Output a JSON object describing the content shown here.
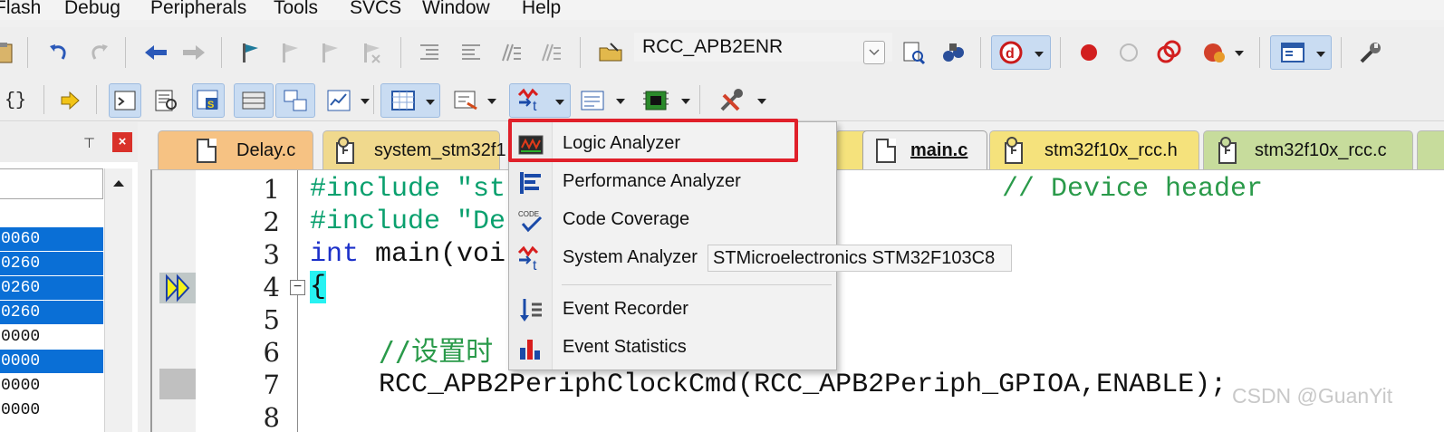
{
  "menubar": {
    "items": [
      "Flash",
      "Debug",
      "Peripherals",
      "Tools",
      "SVCS",
      "Window",
      "Help"
    ]
  },
  "toolbar": {
    "target_combo": "RCC_APB2ENR"
  },
  "left_pane": {
    "rows": [
      {
        "text": "0060",
        "selected": true
      },
      {
        "text": "0260",
        "selected": true
      },
      {
        "text": "0260",
        "selected": true
      },
      {
        "text": "0260",
        "selected": true
      },
      {
        "text": "0000",
        "selected": false
      },
      {
        "text": "0000",
        "selected": true
      },
      {
        "text": "0000",
        "selected": false
      },
      {
        "text": "0000",
        "selected": false
      }
    ],
    "pin_glyph": "⊤",
    "close_glyph": "×"
  },
  "tabs": [
    {
      "label": "Delay.c",
      "color": "#f6c283",
      "active": false
    },
    {
      "label": "system_stm32f1",
      "color": "#f0d98d",
      "active": false
    },
    {
      "label": "main.c",
      "color": "#f0f0f0",
      "active": true
    },
    {
      "label": "stm32f10x_rcc.h",
      "color": "#f5e27c",
      "active": false
    },
    {
      "label": "stm32f10x_rcc.c",
      "color": "#c7dc9c",
      "active": false
    }
  ],
  "editor": {
    "line_numbers": [
      "1",
      "2",
      "3",
      "4",
      "5",
      "6",
      "7",
      "8"
    ],
    "lines": {
      "l1a": "#include \"st",
      "l1b": "// Device header",
      "l2": "#include \"De",
      "l3a": "int",
      "l3b": " main(voi",
      "l4": "{",
      "l6": "//设置时",
      "l7": "RCC_APB2PeriphClockCmd(RCC_APB2Periph_GPIOA,ENABLE);"
    },
    "fold_glyph": "−"
  },
  "dropdown": {
    "items": [
      {
        "label": "Logic Analyzer",
        "icon": "logic-analyzer-icon"
      },
      {
        "label": "Performance Analyzer",
        "icon": "performance-analyzer-icon"
      },
      {
        "label": "Code Coverage",
        "icon": "code-coverage-icon"
      },
      {
        "label": "System Analyzer",
        "icon": "system-analyzer-icon"
      },
      {
        "label": "Event Recorder",
        "icon": "event-recorder-icon"
      },
      {
        "label": "Event Statistics",
        "icon": "event-statistics-icon"
      }
    ],
    "code_icon_text": "CODE"
  },
  "tooltip": "STMicroelectronics STM32F103C8",
  "watermark": "CSDN @GuanYit",
  "colors": {
    "highlight": "#e0202a",
    "selection": "#0a6fd6",
    "preprocessor": "#0aa06e",
    "keyword": "#1c30c9",
    "comment": "#2a9a4a"
  }
}
